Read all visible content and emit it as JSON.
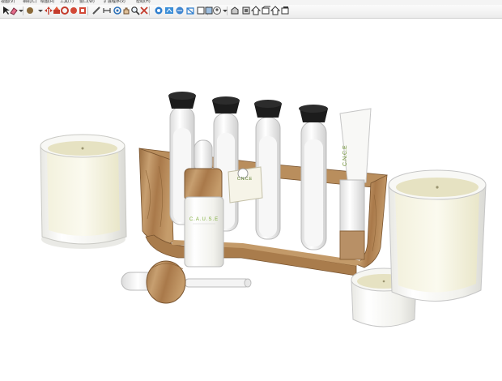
{
  "menu": {
    "items": [
      "视图(V)",
      "相机(C)",
      "绘图(R)",
      "工具(T)",
      "窗口(W)",
      "扩展程序(x)",
      "帮助(H)"
    ]
  },
  "toolbar": {
    "icons": [
      "select-icon",
      "eraser-icon",
      "dropdown-icon",
      "paint-bucket-icon",
      "dropdown-icon",
      "move-icon",
      "push-pull-icon",
      "rotate-icon",
      "follow-me-icon",
      "scale-icon",
      "tape-measure-icon",
      "dimension-icon",
      "orbit-icon",
      "pan-icon",
      "zoom-icon",
      "zoom-extents-icon",
      "section-plane-icon",
      "xray-icon",
      "back-edges-icon",
      "wireframe-icon",
      "hidden-line-icon",
      "shaded-icon",
      "user-icon",
      "dropdown-icon",
      "iso-view-icon",
      "top-view-icon",
      "front-view-icon",
      "right-view-icon",
      "back-view-icon",
      "left-view-icon"
    ]
  },
  "scene": {
    "dropper_bottle_label": "C.A.U.S.E",
    "tag_label": "C.N.C.E",
    "tube_label": "C.N.C.E",
    "colors": {
      "wood": "#b5895a",
      "wood_dark": "#8a6238",
      "glass": "#f4f4ef",
      "wax": "#e7e3c4",
      "cap": "#1c1c1c",
      "accent_green": "#7fae3a"
    }
  }
}
